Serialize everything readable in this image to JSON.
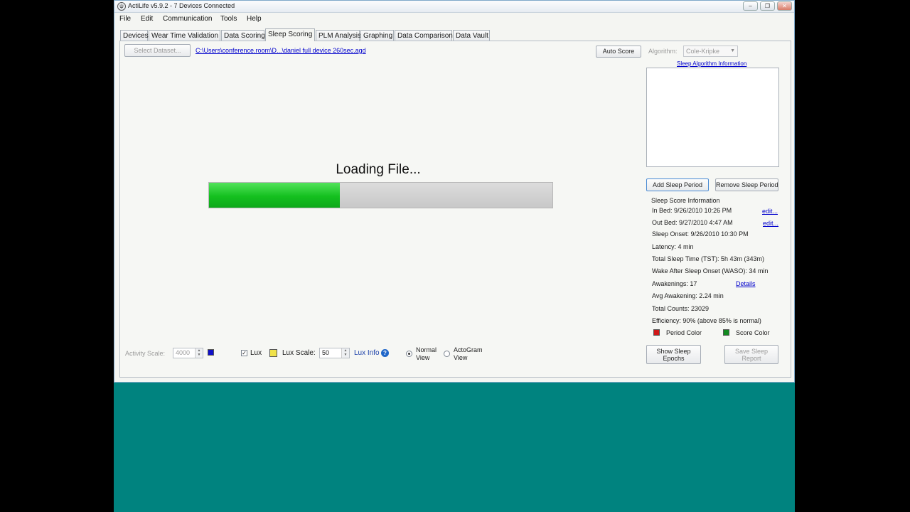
{
  "window": {
    "title": "ActiLife v5.9.2 - 7 Devices Connected",
    "controls": {
      "minimize": "–",
      "restore": "❐",
      "close": "✕"
    }
  },
  "menu": [
    "File",
    "Edit",
    "Communication",
    "Tools",
    "Help"
  ],
  "tabs": [
    "Devices",
    "Wear Time Validation",
    "Data Scoring",
    "Sleep Scoring",
    "PLM Analysis",
    "Graphing",
    "Data Comparison",
    "Data Vault"
  ],
  "active_tab": "Sleep Scoring",
  "toolbar": {
    "select_dataset": "Select Dataset...",
    "dataset_path": "C:\\Users\\conference.room\\D...\\daniel full device 260sec.agd",
    "auto_score": "Auto Score",
    "algorithm_label": "Algorithm:",
    "algorithm_value": "Cole-Kripke",
    "algorithm_info": "Sleep Algorithm Information"
  },
  "loading": {
    "text": "Loading File...",
    "progress_fraction": 0.38
  },
  "sleep_period": {
    "add": "Add Sleep Period",
    "remove": "Remove Sleep Period"
  },
  "score_info": {
    "heading": "Sleep Score Information",
    "in_bed": "In Bed: 9/26/2010 10:26 PM",
    "out_bed": "Out Bed: 9/27/2010 4:47 AM",
    "edit": "edit...",
    "sleep_onset": "Sleep Onset: 9/26/2010 10:30 PM",
    "latency": "Latency: 4 min",
    "tst": "Total Sleep Time (TST): 5h 43m (343m)",
    "waso": "Wake After Sleep Onset (WASO): 34 min",
    "awakenings": "Awakenings: 17",
    "details": "Details",
    "avg_awakening": "Avg Awakening: 2.24 min",
    "total_counts": "Total Counts: 23029",
    "efficiency": "Efficiency: 90% (above 85% is normal)",
    "period_color": "Period Color",
    "score_color": "Score Color"
  },
  "bottom": {
    "activity_scale_label": "Activity Scale:",
    "activity_scale_value": "4000",
    "lux_label": "Lux",
    "lux_scale_label": "Lux Scale:",
    "lux_scale_value": "50",
    "lux_info": "Lux Info",
    "normal_view": "Normal View",
    "actogram_view": "ActoGram View",
    "show_epochs": "Show Sleep Epochs",
    "save_report": "Save Sleep Report"
  },
  "colors": {
    "progress_fill": "#14c01f",
    "activity_swatch": "#1010c8",
    "lux_swatch": "#f0e24a",
    "period_swatch": "#d01818",
    "score_swatch": "#128a20",
    "desktop": "#00837f"
  }
}
